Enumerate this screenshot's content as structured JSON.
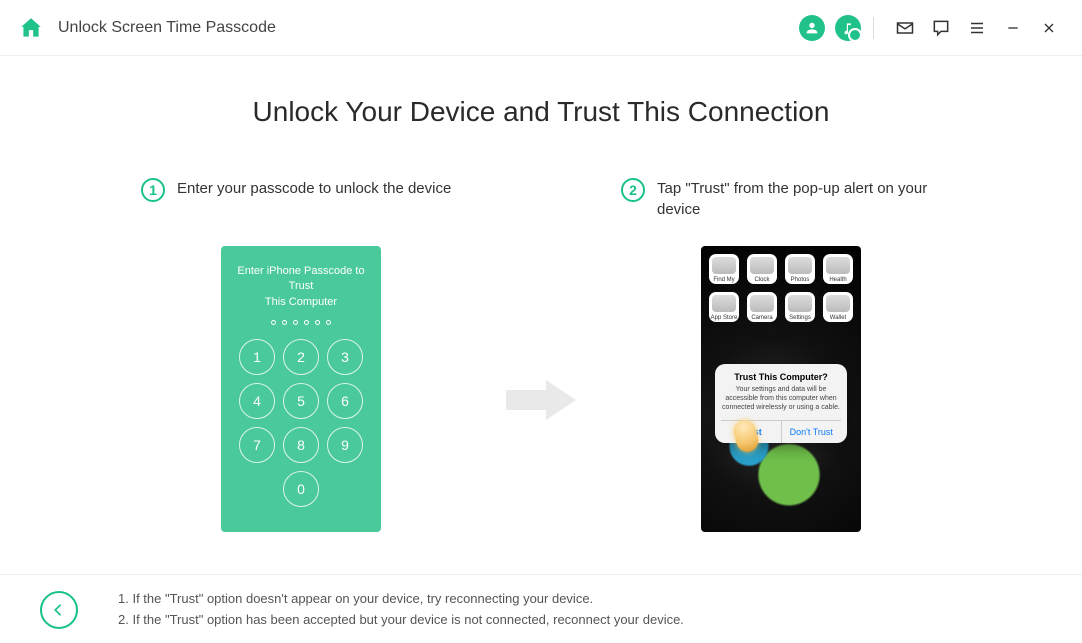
{
  "header": {
    "title": "Unlock Screen Time Passcode"
  },
  "main": {
    "heading": "Unlock Your Device and Trust This Connection",
    "step1": {
      "num": "1",
      "text": "Enter your passcode to unlock the device",
      "phone_title_l1": "Enter iPhone Passcode to Trust",
      "phone_title_l2": "This Computer"
    },
    "step2": {
      "num": "2",
      "text": "Tap \"Trust\" from the pop-up alert on your device",
      "apps": [
        "Find My",
        "Clock",
        "Photos",
        "Health",
        "App Store",
        "Camera",
        "Settings",
        "Wallet"
      ],
      "alert_title": "Trust This Computer?",
      "alert_body": "Your settings and data will be accessible from this computer when connected wirelessly or using a cable.",
      "trust": "Trust",
      "dont_trust": "Don't Trust"
    }
  },
  "footer": {
    "tip1": "1. If the \"Trust\" option doesn't appear on your device, try reconnecting your device.",
    "tip2": "2. If the \"Trust\" option has been accepted but your device is not connected, reconnect your device."
  }
}
